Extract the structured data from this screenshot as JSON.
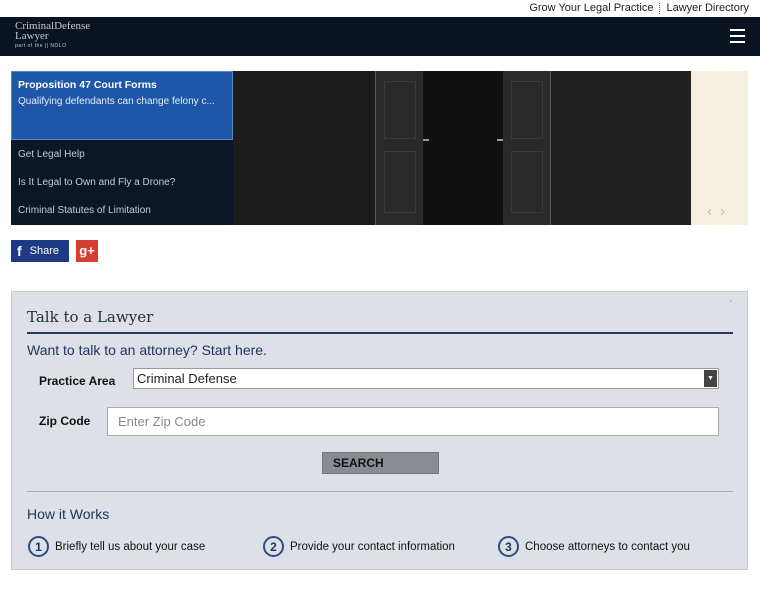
{
  "topbar": {
    "link1": "Grow Your Legal Practice",
    "link2": "Lawyer Directory"
  },
  "header": {
    "logo_line1": "CriminalDefense",
    "logo_line2": "Lawyer",
    "logo_line3": "part of the || NOLO"
  },
  "slider": {
    "active": {
      "title": "Proposition 47 Court Forms",
      "desc": "Qualifying defendants can change felony c..."
    },
    "items": [
      {
        "label": "Get Legal Help"
      },
      {
        "label": "Is It Legal to Own and Fly a Drone?"
      },
      {
        "label": "Criminal Statutes of Limitation"
      }
    ],
    "arrows": "‹ ›"
  },
  "social": {
    "share_label": "Share",
    "facebook_glyph": "f",
    "gplus_glyph": "g+"
  },
  "talk": {
    "close": "˙",
    "title": "Talk to a Lawyer",
    "subtitle": "Want to talk to an attorney? Start here.",
    "practice_label": "Practice Area",
    "practice_value": "Criminal Defense",
    "zip_label": "Zip Code",
    "zip_placeholder": "Enter Zip Code",
    "search_label": "SEARCH",
    "how_title": "How it Works",
    "steps": [
      {
        "num": "1",
        "text": "Briefly tell us about your case"
      },
      {
        "num": "2",
        "text": "Provide your contact information"
      },
      {
        "num": "3",
        "text": "Choose attorneys to contact you"
      }
    ]
  }
}
